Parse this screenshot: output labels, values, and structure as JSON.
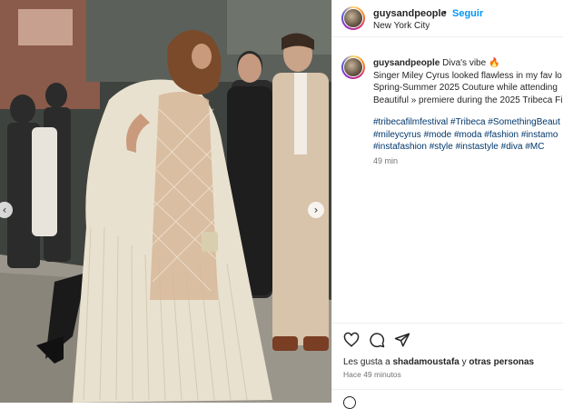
{
  "post": {
    "username": "guysandpeople",
    "follow_label": "Seguir",
    "separator": "•",
    "location": "New York City",
    "caption_user": "guysandpeople",
    "caption_title": "Diva's vibe 🔥",
    "caption_lines": [
      "Singer Miley Cyrus looked flawless in my fav lo",
      "Spring-Summer 2025 Couture while attending",
      "Beautiful » premiere during the 2025 Tribeca Fi"
    ],
    "hashtag_lines": [
      [
        "#tribecafilmfestival",
        "#Tribeca",
        "#SomethingBeaut"
      ],
      [
        "#mileycyrus",
        "#mode",
        "#moda",
        "#fashion",
        "#instamo"
      ],
      [
        "#instafashion",
        "#style",
        "#instastyle",
        "#diva",
        "#MC"
      ]
    ],
    "time_ago": "49 min",
    "likes_prefix": "Les gusta a ",
    "likes_user": "shadamoustafa",
    "likes_middle": " y ",
    "likes_others": "otras personas",
    "posted_ago": "Hace 49 minutos"
  },
  "photo": {
    "prev_label": "‹",
    "next_label": "›"
  },
  "icons": {
    "like": "heart-icon",
    "comment": "comment-icon",
    "share": "share-icon",
    "emoji": "emoji-icon",
    "nav_prev": "chevron-left-icon",
    "nav_next": "chevron-right-icon"
  },
  "colors": {
    "link_blue": "#0095f6",
    "hashtag": "#00376b",
    "muted": "#737373"
  }
}
